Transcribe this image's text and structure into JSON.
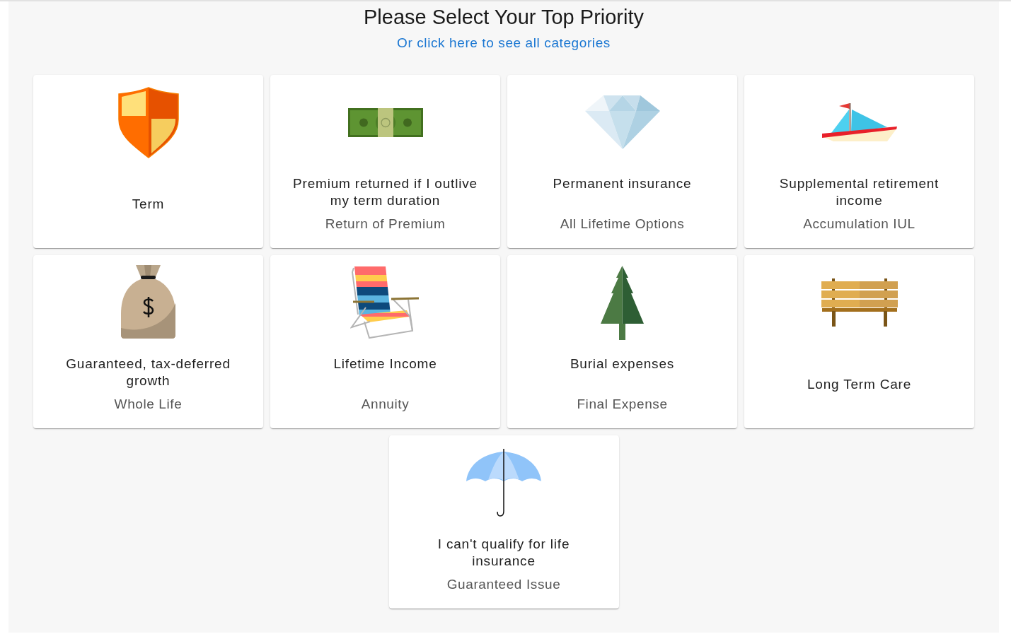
{
  "header": {
    "title": "Please Select Your Top Priority",
    "link": "Or click here to see all categories"
  },
  "categories": [
    {
      "title": "Term"
    },
    {
      "title": "Premium returned if I outlive my term duration",
      "subtitle": "Return of Premium"
    },
    {
      "title": "Permanent insurance",
      "subtitle": "All Lifetime Options"
    },
    {
      "title": "Supplemental retirement income",
      "subtitle": "Accumulation IUL"
    },
    {
      "title": "Guaranteed, tax-deferred growth",
      "subtitle": "Whole Life"
    },
    {
      "title": "Lifetime Income",
      "subtitle": "Annuity"
    },
    {
      "title": "Burial expenses",
      "subtitle": "Final Expense"
    },
    {
      "title": "Long Term Care"
    },
    {
      "title": "I can't qualify for life insurance",
      "subtitle": "Guaranteed Issue"
    }
  ]
}
